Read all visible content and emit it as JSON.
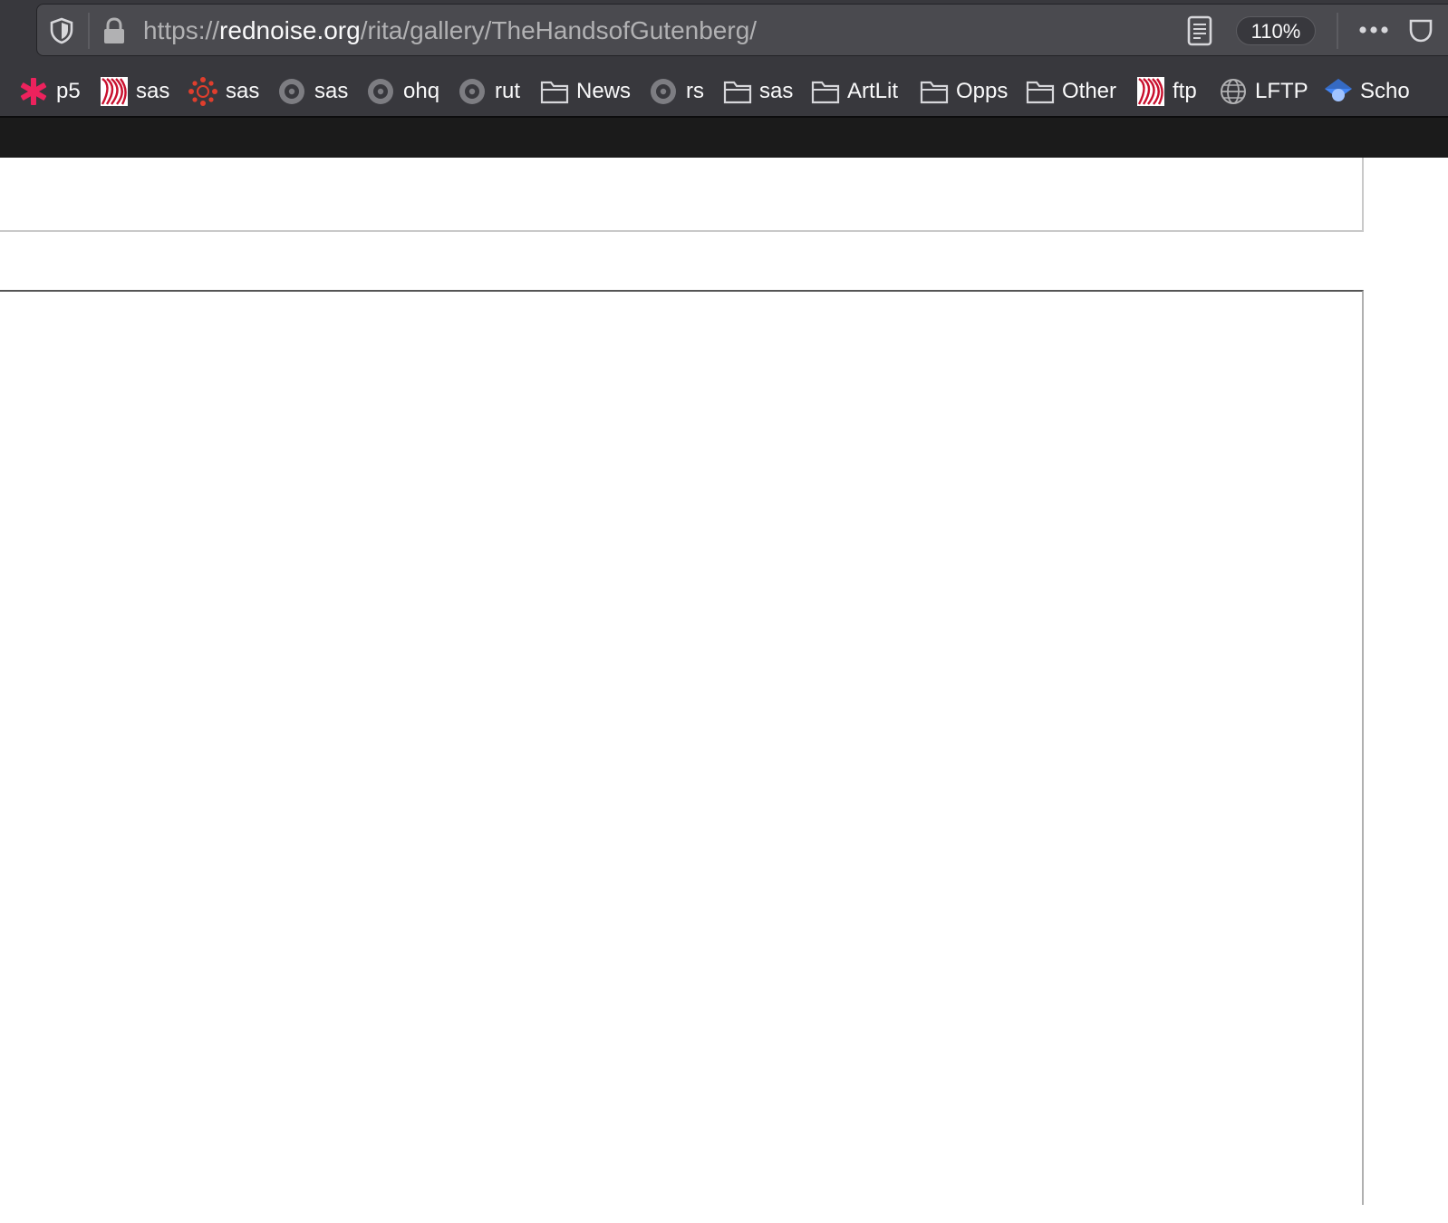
{
  "url": {
    "scheme": "https://",
    "host": "rednoise.org",
    "path": "/rita/gallery/TheHandsofGutenberg/"
  },
  "zoom": "110%",
  "bookmarks": [
    {
      "label": "p5",
      "icon": "p5-asterisk-icon"
    },
    {
      "label": "sas",
      "icon": "striped-logo-icon"
    },
    {
      "label": "sas",
      "icon": "canvas-logo-icon"
    },
    {
      "label": "sas",
      "icon": "grey-ring-icon"
    },
    {
      "label": "ohq",
      "icon": "grey-ring-icon"
    },
    {
      "label": "rut",
      "icon": "grey-ring-icon"
    },
    {
      "label": "News",
      "icon": "folder-icon"
    },
    {
      "label": "rs",
      "icon": "grey-ring-icon"
    },
    {
      "label": "sas",
      "icon": "folder-icon"
    },
    {
      "label": "ArtLit",
      "icon": "folder-icon"
    },
    {
      "label": "Opps",
      "icon": "folder-icon"
    },
    {
      "label": "Other",
      "icon": "folder-icon"
    },
    {
      "label": "ftp",
      "icon": "striped-logo-icon"
    },
    {
      "label": "LFTP",
      "icon": "globe-icon"
    },
    {
      "label": "Scho",
      "icon": "scholar-cap-icon"
    }
  ],
  "colors": {
    "toolbar": "#38383d",
    "url_field": "#4a4a4f",
    "text_light": "#f9f9fa",
    "text_dim": "#b1b1b3",
    "dark_band": "#1b1b1b",
    "p5_pink": "#ed225d",
    "brand_red": "#c8102e",
    "scholar_blue": "#4285f4"
  }
}
